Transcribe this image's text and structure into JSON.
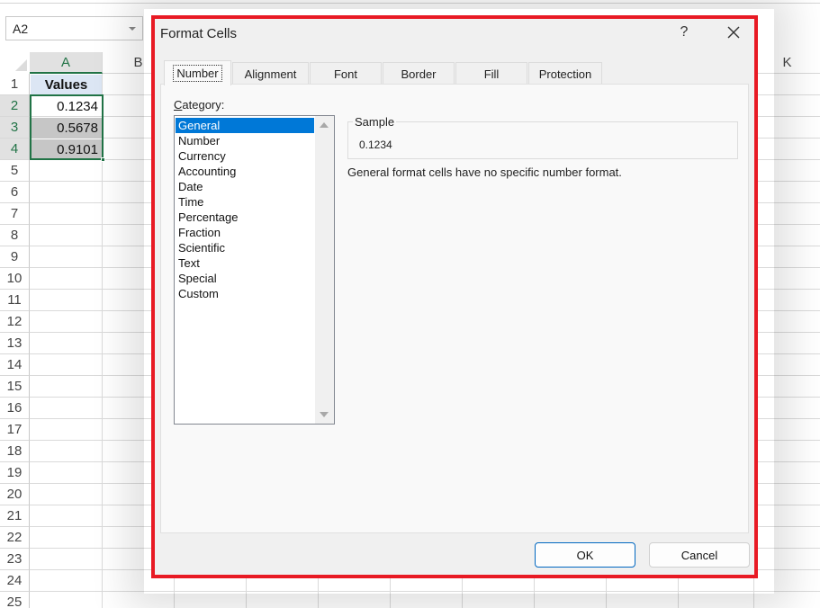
{
  "name_box": {
    "value": "A2"
  },
  "spreadsheet": {
    "columns": [
      "A",
      "B",
      "K"
    ],
    "active_column": "A",
    "rows": [
      "1",
      "2",
      "3",
      "4",
      "5",
      "6",
      "7",
      "8",
      "9",
      "10",
      "11",
      "12",
      "13",
      "14",
      "15",
      "16",
      "17",
      "18",
      "19",
      "20",
      "21",
      "22",
      "23",
      "24",
      "25"
    ],
    "cells": {
      "A1": "Values",
      "A2": "0.1234",
      "A3": "0.5678",
      "A4": "0.9101"
    }
  },
  "dialog": {
    "title": "Format Cells",
    "help_label": "?",
    "highlight_color": "#e81a24",
    "tabs": [
      {
        "label": "Number",
        "active": true
      },
      {
        "label": "Alignment",
        "active": false
      },
      {
        "label": "Font",
        "active": false
      },
      {
        "label": "Border",
        "active": false
      },
      {
        "label": "Fill",
        "active": false
      },
      {
        "label": "Protection",
        "active": false
      }
    ],
    "category_label_accel": "C",
    "category_label_rest": "ategory:",
    "categories": [
      "General",
      "Number",
      "Currency",
      "Accounting",
      "Date",
      "Time",
      "Percentage",
      "Fraction",
      "Scientific",
      "Text",
      "Special",
      "Custom"
    ],
    "selected_category": "General",
    "sample_label": "Sample",
    "sample_value": "0.1234",
    "description": "General format cells have no specific number format.",
    "ok_label": "OK",
    "cancel_label": "Cancel"
  },
  "colors": {
    "selection_blue": "#0078d7",
    "excel_green": "#217346",
    "header_fill": "#dce6f4"
  }
}
